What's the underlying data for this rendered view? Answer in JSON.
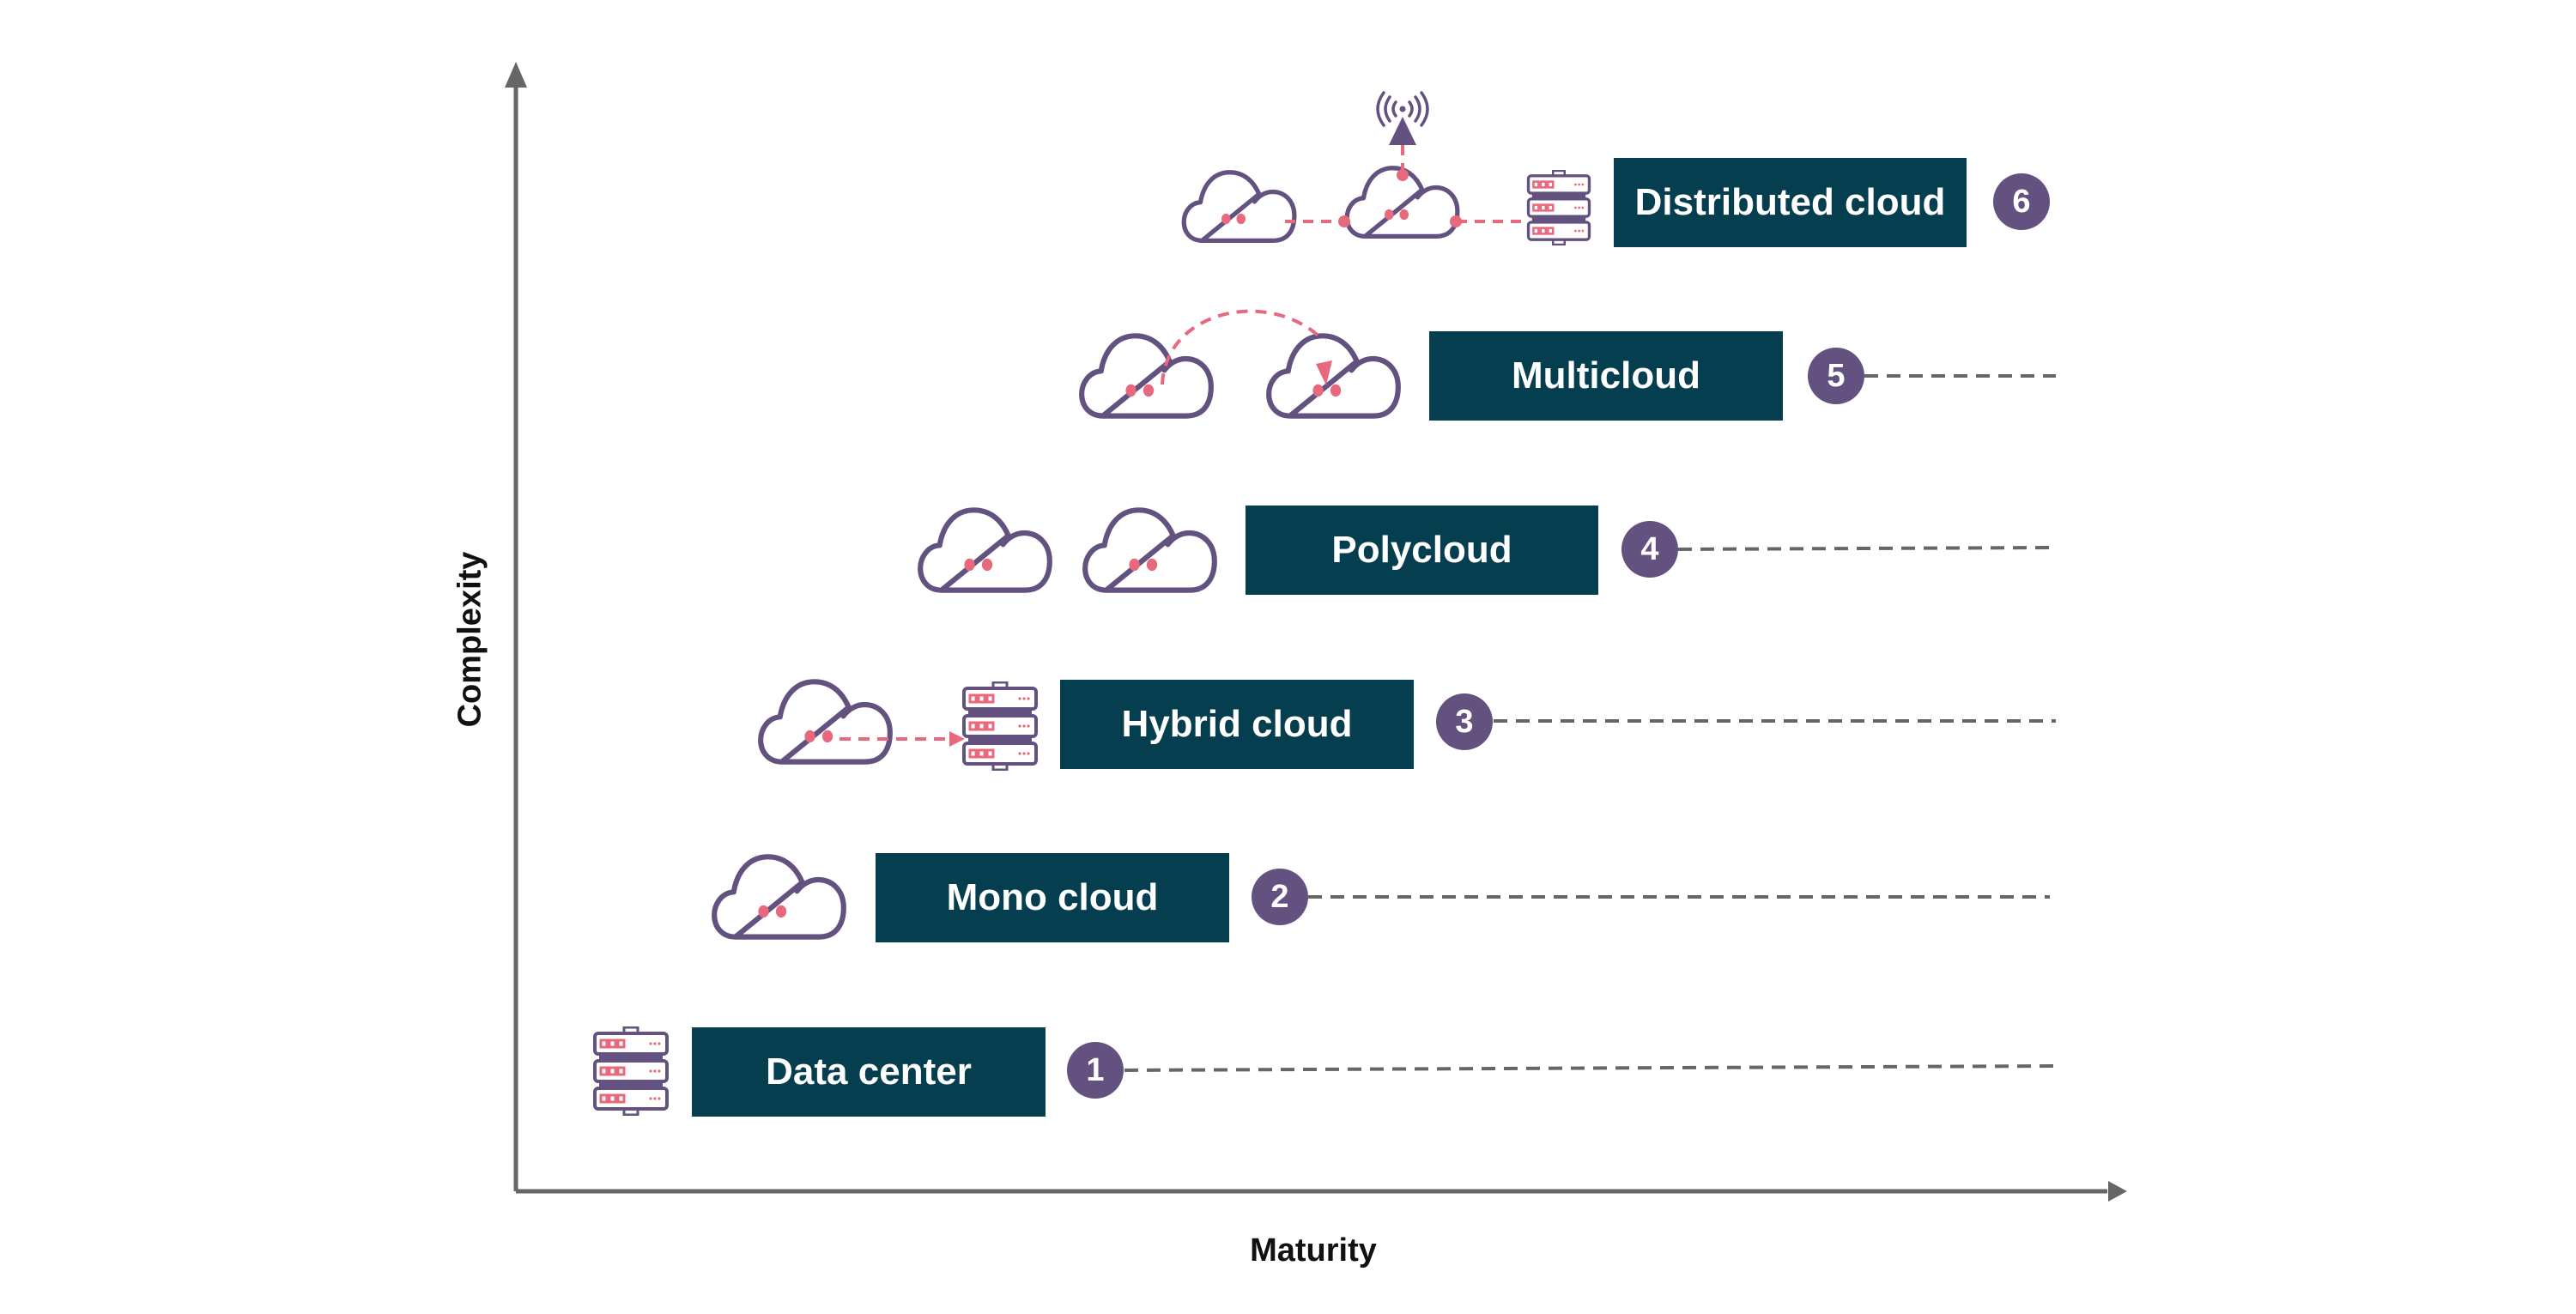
{
  "axes": {
    "y_label": "Complexity",
    "x_label": "Maturity"
  },
  "colors": {
    "box": "#043E4F",
    "badge": "#63517F",
    "icon_stroke": "#63517F",
    "accent": "#E8697D",
    "axis": "#666666",
    "leader": "#666666"
  },
  "stages": [
    {
      "number": "1",
      "label": "Data center",
      "icons": [
        "server-rack-icon"
      ]
    },
    {
      "number": "2",
      "label": "Mono cloud",
      "icons": [
        "cloud-icon"
      ]
    },
    {
      "number": "3",
      "label": "Hybrid cloud",
      "icons": [
        "cloud-icon",
        "arrow-right-icon",
        "server-rack-icon"
      ]
    },
    {
      "number": "4",
      "label": "Polycloud",
      "icons": [
        "cloud-icon",
        "cloud-icon"
      ]
    },
    {
      "number": "5",
      "label": "Multicloud",
      "icons": [
        "cloud-icon",
        "curved-arrow-icon",
        "cloud-icon"
      ]
    },
    {
      "number": "6",
      "label": "Distributed cloud",
      "icons": [
        "cloud-icon",
        "cloud-icon",
        "antenna-tower-icon",
        "server-rack-icon"
      ]
    }
  ]
}
